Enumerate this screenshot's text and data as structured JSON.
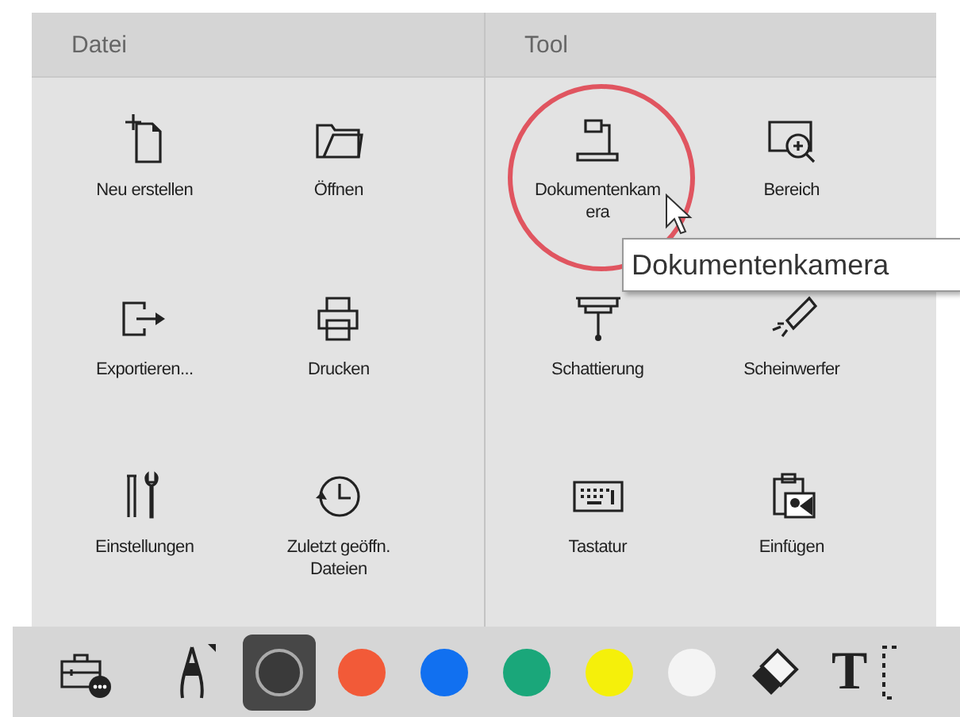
{
  "sections": [
    {
      "title": "Datei",
      "items": [
        {
          "kind": "new",
          "label": "Neu erstellen"
        },
        {
          "kind": "open",
          "label": "Öffnen"
        },
        {
          "kind": "export",
          "label": "Exportieren..."
        },
        {
          "kind": "print",
          "label": "Drucken"
        },
        {
          "kind": "settings",
          "label": "Einstellungen"
        },
        {
          "kind": "recent",
          "label": "Zuletzt geöffn. Dateien"
        }
      ]
    },
    {
      "title": "Tool",
      "items": [
        {
          "kind": "camera",
          "label": "Dokumentenkamera",
          "highlighted": true
        },
        {
          "kind": "zoom",
          "label": "Bereich"
        },
        {
          "kind": "shade",
          "label": "Schattierung"
        },
        {
          "kind": "spotlight",
          "label": "Scheinwerfer"
        },
        {
          "kind": "keyboard",
          "label": "Tastatur"
        },
        {
          "kind": "paste",
          "label": "Einfügen"
        }
      ]
    }
  ],
  "tooltip": "Dokumentenkamera",
  "toolbar": {
    "text_tool": "T",
    "colors": [
      {
        "color": "#3a3a3a",
        "selected": true
      },
      {
        "color": "#f25a38",
        "selected": false
      },
      {
        "color": "#1170f0",
        "selected": false
      },
      {
        "color": "#1aa77a",
        "selected": false
      },
      {
        "color": "#f5f00a",
        "selected": false
      },
      {
        "color": "#f4f4f4",
        "selected": false
      }
    ]
  }
}
